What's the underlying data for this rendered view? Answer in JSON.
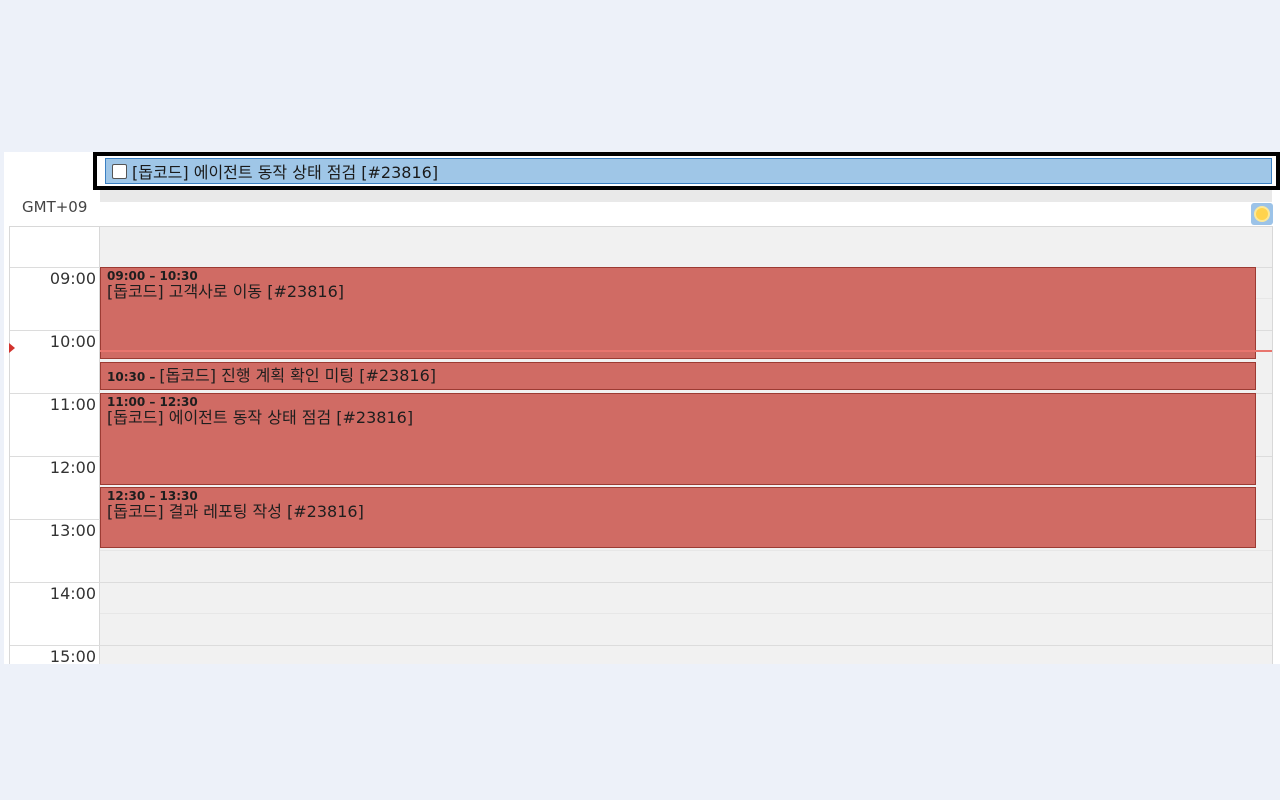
{
  "allday": {
    "event_title": "[돕코드] 에이전트 동작 상태 점검 [#23816]"
  },
  "timezone": "GMT+09",
  "icons": {
    "weather": "sun-weather-icon"
  },
  "hours": [
    "09:00",
    "10:00",
    "11:00",
    "12:00",
    "13:00",
    "14:00",
    "15:00"
  ],
  "events": [
    {
      "time": "09:00 – 10:30",
      "title": "[돕코드] 고객사로 이동 [#23816]"
    },
    {
      "time": "10:30 –",
      "title": "[돕코드] 진행 계획 확인 미팅 [#23816]"
    },
    {
      "time": "11:00 – 12:30",
      "title": "[돕코드] 에이전트 동작 상태 점검 [#23816]"
    },
    {
      "time": "12:30 – 13:30",
      "title": "[돕코드] 결과 레포팅 작성 [#23816]"
    }
  ],
  "colors": {
    "page_background": "#edf1f9",
    "event_fill": "#d06b64",
    "event_border": "#9c3b33",
    "allday_fill": "#9fc6e7",
    "now_line": "#e8756e"
  }
}
